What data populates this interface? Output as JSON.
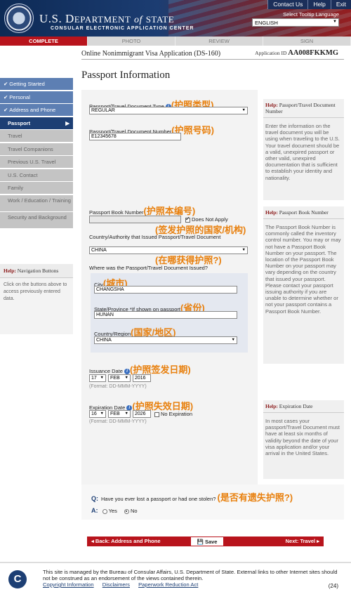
{
  "header": {
    "title_prefix": "U.S. D",
    "title_main": "EPARTMENT",
    "title_of": "of",
    "title_state": "STATE",
    "subtitle": "CONSULAR ELECTRONIC APPLICATION CENTER",
    "links": [
      "Contact Us",
      "Help",
      "Exit"
    ],
    "tooltip_language_label": "Select Tooltip Language",
    "language_value": "ENGLISH"
  },
  "progress": [
    "COMPLETE",
    "PHOTO",
    "REVIEW",
    "SIGN"
  ],
  "form_title": "Online Nonimmigrant Visa Application (DS-160)",
  "app_id_label": "Application ID",
  "app_id_value": "AA008FKKMG",
  "page_title": "Passport Information",
  "sidebar": {
    "items": [
      {
        "label": "Getting Started",
        "state": "done"
      },
      {
        "label": "Personal",
        "state": "done"
      },
      {
        "label": "Address and Phone",
        "state": "done"
      },
      {
        "label": "Passport",
        "state": "current"
      },
      {
        "label": "Travel",
        "state": "todo"
      },
      {
        "label": "Travel Companions",
        "state": "todo"
      },
      {
        "label": "Previous U.S. Travel",
        "state": "todo"
      },
      {
        "label": "U.S. Contact",
        "state": "todo"
      },
      {
        "label": "Family",
        "state": "todo"
      },
      {
        "label": "Work / Education / Training",
        "state": "todo"
      },
      {
        "label": "Security and Background",
        "state": "todo"
      }
    ],
    "help_title_prefix": "Help:",
    "help_title": "Navigation Buttons",
    "help_text": "Click on the buttons above to access previously entered data."
  },
  "form": {
    "doc_type_label": "Passport/Travel Document Type",
    "doc_type_cn": "(护照类型)",
    "doc_type_value": "REGULAR",
    "doc_number_label": "Passport/Travel Document Number",
    "doc_number_cn": "(护照号码)",
    "doc_number_value": "E12345678",
    "book_number_label": "Passport Book Number",
    "book_number_cn": "(护照本编号)",
    "book_number_value": "",
    "does_not_apply": "Does Not Apply",
    "issuing_country_cn": "(签发护照的国家/机构)",
    "issuing_country_label": "Country/Authority that Issued Passport/Travel Document",
    "issuing_country_value": "CHINA",
    "where_cn": "(在哪获得护照?)",
    "where_label": "Where was the Passport/Travel Document Issued?",
    "city_label": "City",
    "city_cn": "(城市)",
    "city_value": "CHANGSHA",
    "state_label": "State/Province *If shown on passport",
    "state_cn": "(省份)",
    "state_value": "HUNAN",
    "country_label": "Country/Region",
    "country_cn": "(国家/地区)",
    "country_value": "CHINA",
    "issuance_label": "Issuance Date",
    "issuance_cn": "(护照签发日期)",
    "issuance_day": "17",
    "issuance_month": "FEB",
    "issuance_year": "2016",
    "format_text": "(Format: DD-MMM-YYYY)",
    "expiration_label": "Expiration Date",
    "expiration_cn": "(护照失效日期)",
    "expiration_day": "16",
    "expiration_month": "FEB",
    "expiration_year": "2026",
    "no_expiration": "No Expiration"
  },
  "help_panels": [
    {
      "prefix": "Help:",
      "title": "Passport/Travel Document Number",
      "text": "Enter the information on the travel document you will be using when traveling to the U.S. Your travel document should be a valid, unexpired passport or other valid, unexpired documentation that is sufficient to establish your identity and nationality."
    },
    {
      "prefix": "Help:",
      "title": "Passport Book Number",
      "text": "The Passport Book Number is commonly called the inventory control number. You may or may not have a Passport Book Number on your passport. The location of the Passport Book Number on your passport may vary depending on the country that issued your passport. Please contact your passport issuing authority if you are unable to determine whether or not your passport contains a Passport Book Number."
    },
    {
      "prefix": "Help:",
      "title": "Expiration Date",
      "text": "In most cases your passport/Travel Document must have at least six months of validity beyond the date of your visa application and/or your arrival in the United States."
    }
  ],
  "question": {
    "q_marker": "Q:",
    "q_text": "Have you ever lost a passport or had one stolen?",
    "q_cn": "(是否有遗失护照?)",
    "a_marker": "A:",
    "yes": "Yes",
    "no": "No",
    "selected": "No"
  },
  "buttons": {
    "back": "◂ Back: Address and Phone",
    "save": "Save",
    "next": "Next: Travel ▸"
  },
  "footer": {
    "logo": "C",
    "text": "This site is managed by the Bureau of Consular Affairs, U.S. Department of State. External links to other Internet sites should not be construed as an endorsement of the views contained therein.",
    "links": [
      "Copyright Information",
      "Disclaimers",
      "Paperwork Reduction Act"
    ],
    "page_num": "(24)"
  }
}
